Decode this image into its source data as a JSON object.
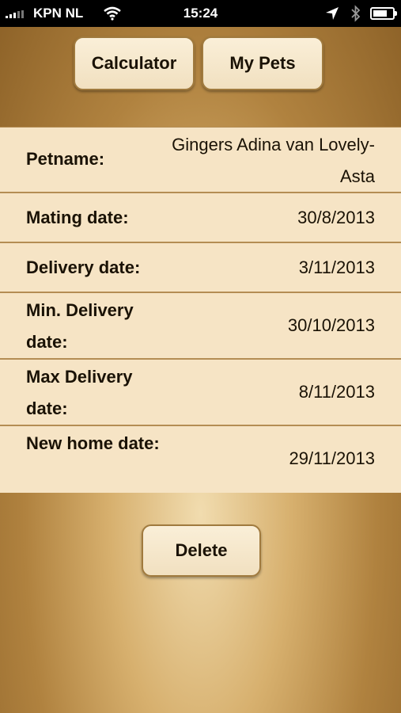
{
  "status_bar": {
    "carrier": "KPN NL",
    "time": "15:24",
    "battery_level": 0.75
  },
  "toolbar": {
    "calculator_label": "Calculator",
    "my_pets_label": "My Pets"
  },
  "details": {
    "petname": {
      "label": "Petname:",
      "value": "Gingers Adina van Lovely-Asta"
    },
    "mating_date": {
      "label": "Mating date:",
      "value": "30/8/2013"
    },
    "delivery_date": {
      "label": "Delivery date:",
      "value": "3/11/2013"
    },
    "min_delivery_date": {
      "label": "Min. Delivery date:",
      "value": "30/10/2013"
    },
    "max_delivery_date": {
      "label": "Max Delivery date:",
      "value": "8/11/2013"
    },
    "new_home_date": {
      "label": "New home date:",
      "value": "29/11/2013"
    }
  },
  "actions": {
    "delete_label": "Delete"
  },
  "colors": {
    "background": "#b0823f",
    "row_background": "#f6e4c5",
    "button_background": "#f6e6c8",
    "divider": "#b48d54"
  },
  "icons": [
    "signal-icon",
    "wifi-icon",
    "location-icon",
    "bluetooth-icon",
    "battery-icon"
  ]
}
